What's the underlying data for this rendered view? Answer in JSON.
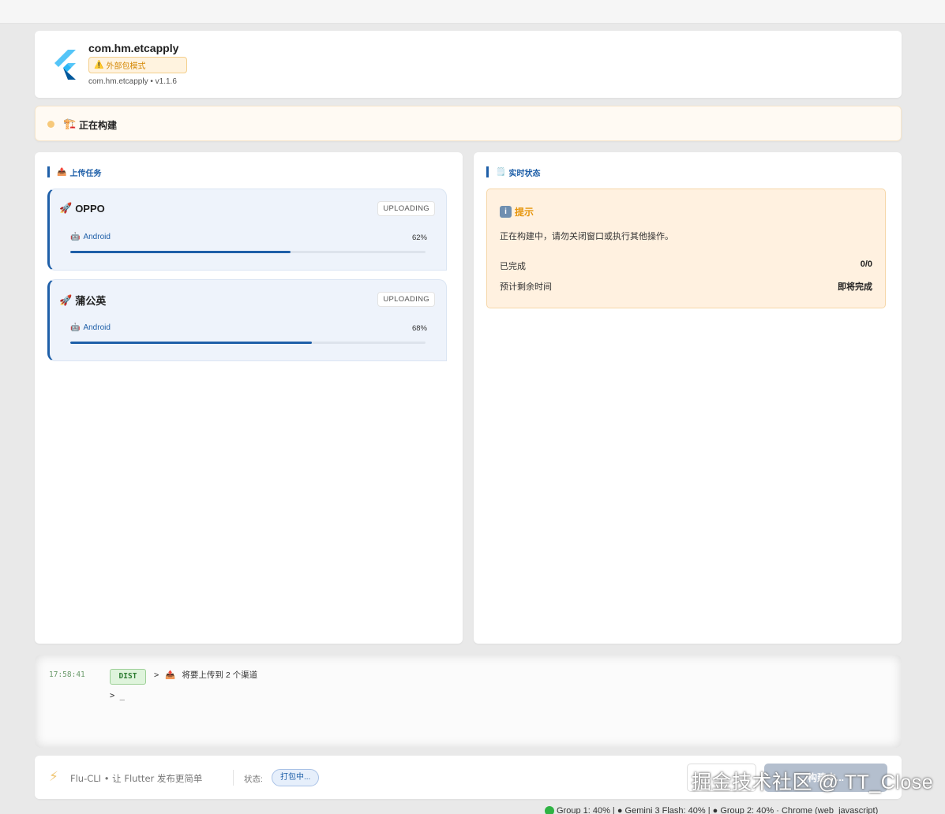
{
  "header": {
    "app_name": "com.hm.etcapply",
    "mode_badge": "外部包模式",
    "meta": "com.hm.etcapply • v1.1.6"
  },
  "status": {
    "text": "正在构建",
    "dot_color": "#f7c97a"
  },
  "upload_panel": {
    "title": "上传任务",
    "tasks": [
      {
        "name": "OPPO",
        "state": "UPLOADING",
        "platform": "Android",
        "progress": 62,
        "progress_label": "62%"
      },
      {
        "name": "蒲公英",
        "state": "UPLOADING",
        "platform": "Android",
        "progress": 68,
        "progress_label": "68%"
      }
    ]
  },
  "status_panel": {
    "title": "实时状态",
    "tip_title": "提示",
    "tip_message": "正在构建中，请勿关闭窗口或执行其他操作。",
    "rows": [
      {
        "label": "已完成",
        "value": "0/0"
      },
      {
        "label": "预计剩余时间",
        "value": "即将完成"
      }
    ]
  },
  "console": {
    "time": "17:58:41",
    "tag": "DIST",
    "arrow": ">",
    "message": "将要上传到  2  个渠道",
    "prompt": ">  _"
  },
  "footer": {
    "brand": "Flu-CLI • 让 Flutter 发布更简单",
    "state_label": "状态:",
    "state_value": "打包中...",
    "primary_button": "构建中..."
  },
  "watermark": "掘金技术社区 @ TT_Close",
  "bottom_bar": "Group 1: 40% | ● Gemini 3 Flash: 40% | ● Group 2: 40%  ·  Chrome (web_javascript)",
  "colors": {
    "accent": "#1e5fa8",
    "warning": "#e6960e",
    "success": "#2e7d32"
  }
}
